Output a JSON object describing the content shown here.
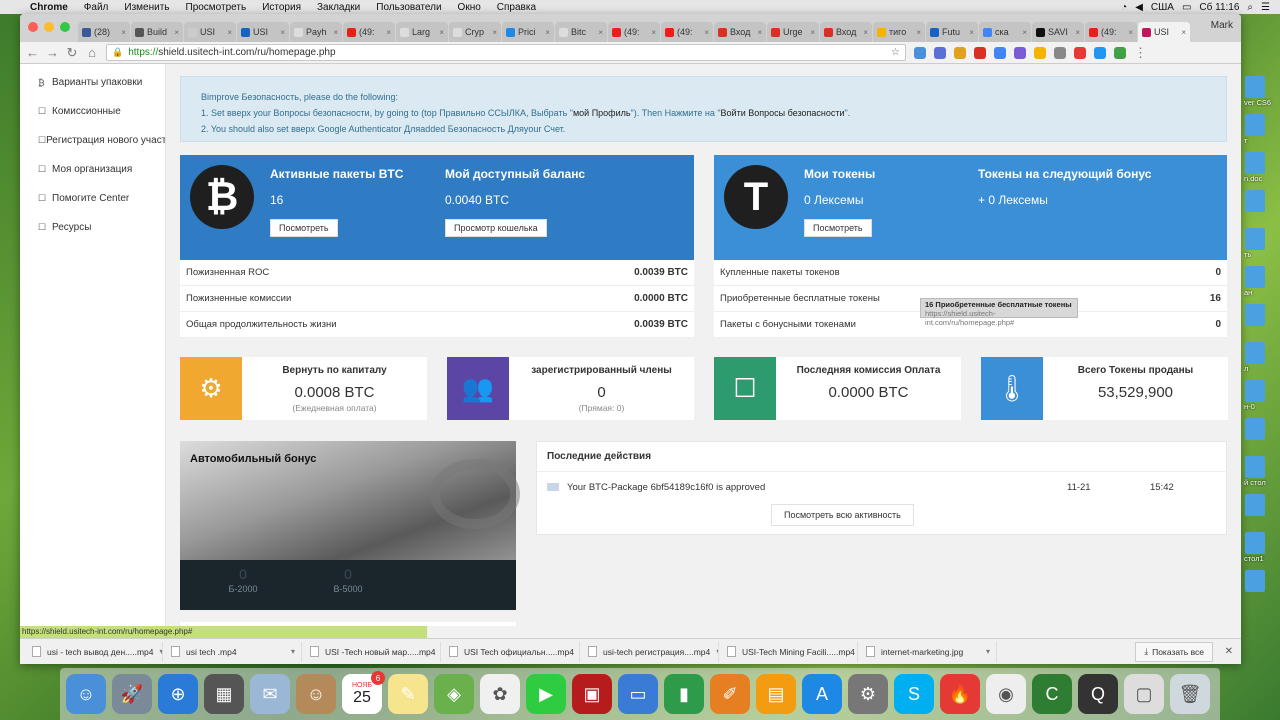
{
  "menubar": {
    "app": "Chrome",
    "items": [
      "Файл",
      "Изменить",
      "Просмотреть",
      "История",
      "Закладки",
      "Пользователи",
      "Окно",
      "Справка"
    ],
    "input_source": "США",
    "clock": "Сб 11:16"
  },
  "browser": {
    "tabs": [
      {
        "label": "(28)",
        "color": "#3b5998"
      },
      {
        "label": "Build",
        "color": "#555555"
      },
      {
        "label": "USI",
        "color": "#cccccc"
      },
      {
        "label": "USI",
        "color": "#1565c0"
      },
      {
        "label": "Payh",
        "color": "#dddddd"
      },
      {
        "label": "(49:",
        "color": "#e62117"
      },
      {
        "label": "Larg",
        "color": "#dddddd"
      },
      {
        "label": "Cryp",
        "color": "#dddddd"
      },
      {
        "label": "Prici",
        "color": "#1e88e5"
      },
      {
        "label": "Bitc",
        "color": "#dddddd"
      },
      {
        "label": "(49:",
        "color": "#e62117"
      },
      {
        "label": "(49:",
        "color": "#e62117"
      },
      {
        "label": "Вход",
        "color": "#d93025"
      },
      {
        "label": "Urge",
        "color": "#d93025"
      },
      {
        "label": "Вход",
        "color": "#d93025"
      },
      {
        "label": "тиго",
        "color": "#f4b400"
      },
      {
        "label": "Futu",
        "color": "#1565c0"
      },
      {
        "label": "ска",
        "color": "#4285f4"
      },
      {
        "label": "SAVI",
        "color": "#111111"
      },
      {
        "label": "(49:",
        "color": "#e62117"
      },
      {
        "label": "USI",
        "color": "#c2185b"
      }
    ],
    "profile": "Mark",
    "url_protocol": "https://",
    "url_rest": "shield.usitech-int.com/ru/homepage.php"
  },
  "sidebar": {
    "items": [
      {
        "icon": "₿",
        "label": "Варианты упаковки"
      },
      {
        "icon": "☐",
        "label": "Комиссионные"
      },
      {
        "icon": "☐",
        "label": "Регистрация нового участника"
      },
      {
        "icon": "☐",
        "label": "Моя организация"
      },
      {
        "icon": "☐",
        "label": "Помогите Center"
      },
      {
        "icon": "☐",
        "label": "Ресурсы"
      }
    ]
  },
  "alert": {
    "intro": "Bimprove Безопасность, please do the following:",
    "line1_prefix": "1. Set вверх your Вопросы безопасности, by going to (top Правильно ССЫЛКА, Выбрать \"",
    "line1_link1": "мой Профиль",
    "line1_mid": "\"). Then Нажмите на \"",
    "line1_link2": "Войти Вопросы безопасности",
    "line1_suffix": "\".",
    "line2": "2. You should also set вверх Google Authenticator Дляadded Безопасность Дляyour Счет."
  },
  "btc_panel": {
    "logo": "₿",
    "active_label": "Активные пакеты BTC",
    "active_value": "16",
    "active_btn": "Посмотреть",
    "balance_label": "Мой доступный баланс",
    "balance_value": "0.0040 BTC",
    "balance_btn": "Просмотр кошелька",
    "rows": [
      {
        "label": "Пожизненная ROC",
        "value": "0.0039 BTC"
      },
      {
        "label": "Пожизненные комиссии",
        "value": "0.0000 BTC"
      },
      {
        "label": "Общая продолжительность жизни",
        "value": "0.0039 BTC"
      }
    ]
  },
  "token_panel": {
    "logo": "T",
    "tokens_label": "Мои токены",
    "tokens_value": "0 Лексемы",
    "tokens_btn": "Посмотреть",
    "next_label": "Токены на следующий бонус",
    "next_value": "+ 0 Лексемы",
    "rows": [
      {
        "label": "Купленные пакеты токенов",
        "value": "0"
      },
      {
        "label": "Приобретенные бесплатные токены",
        "value": "16"
      },
      {
        "label": "Пакеты с бонусными токенами",
        "value": "0"
      }
    ]
  },
  "tooltip": {
    "title": "16 Приобретенные бесплатные токены",
    "url": "https://shield.usitech-int.com/ru/homepage.php#"
  },
  "tiles": [
    {
      "icon": "⚙",
      "color": "#f0a830",
      "title": "Вернуть по капиталу",
      "value": "0.0008 BTC",
      "sub": "(Ежедневная оплата)"
    },
    {
      "icon": "👥",
      "color": "#5b46a6",
      "title": "зарегистрированный члены",
      "value": "0",
      "sub": "(Прямая: 0)"
    },
    {
      "icon": "☐",
      "color": "#2e9b6e",
      "title": "Последняя комиссия Оплата",
      "value": "0.0000 BTC",
      "sub": ""
    },
    {
      "icon": "🌡",
      "color": "#3a8fd6",
      "title": "Всего Токены проданы",
      "value": "53,529,900",
      "sub": ""
    }
  ],
  "car_bonus": {
    "title": "Автомобильный бонус",
    "counters": [
      {
        "value": "0",
        "label": "Б-2000"
      },
      {
        "value": "0",
        "label": "В-5000"
      }
    ]
  },
  "activity": {
    "title": "Последние действия",
    "items": [
      {
        "text": "Your BTC-Package 6bf54189c16f0 is approved",
        "date": "11-21",
        "time": "15:42"
      }
    ],
    "button": "Посмотреть всю активность"
  },
  "status_url": "https://shield.usitech-int.com/ru/homepage.php#",
  "downloads": {
    "items": [
      "usi - tech  вывод ден.....mp4",
      "usi tech .mp4",
      "USI -Tech новый мар.....mp4",
      "USI Tech официальн.....mp4",
      "usi-tech регистрация....mp4",
      "USI-Tech Mining Facili.....mp4",
      "internet-marketing.jpg"
    ],
    "show_all": "Показать все"
  },
  "desktop": {
    "labels": [
      "ver CS6",
      "т",
      "n.doc",
      "",
      "ть",
      "ан",
      "",
      "л",
      "н-0",
      "",
      "й стол",
      "",
      "стол1",
      ""
    ]
  },
  "dock": {
    "calendar_day": "25",
    "calendar_month": "НОЯБ",
    "calendar_badge": "6",
    "apps": [
      {
        "name": "finder",
        "color": "#4a90d9",
        "glyph": "☺"
      },
      {
        "name": "launchpad",
        "color": "#7a8a99",
        "glyph": "🚀"
      },
      {
        "name": "safari",
        "color": "#2a7ad8",
        "glyph": "⊕"
      },
      {
        "name": "apps",
        "color": "#555555",
        "glyph": "▦"
      },
      {
        "name": "mail",
        "color": "#9ab7d6",
        "glyph": "✉"
      },
      {
        "name": "contacts",
        "color": "#b58a5a",
        "glyph": "☺"
      },
      {
        "name": "calendar",
        "color": "#ffffff",
        "glyph": ""
      },
      {
        "name": "notes",
        "color": "#f6e58d",
        "glyph": "✎"
      },
      {
        "name": "maps",
        "color": "#6ab04c",
        "glyph": "◈"
      },
      {
        "name": "photos",
        "color": "#f0f0f0",
        "glyph": "✿"
      },
      {
        "name": "facetime",
        "color": "#2ecc40",
        "glyph": "▶"
      },
      {
        "name": "photo-booth",
        "color": "#b71c1c",
        "glyph": "▣"
      },
      {
        "name": "keynote",
        "color": "#3a7bd5",
        "glyph": "▭"
      },
      {
        "name": "numbers",
        "color": "#2e9b4a",
        "glyph": "▮"
      },
      {
        "name": "pages",
        "color": "#e67e22",
        "glyph": "✐"
      },
      {
        "name": "ibooks",
        "color": "#f39c12",
        "glyph": "▤"
      },
      {
        "name": "app-store",
        "color": "#1e88e5",
        "glyph": "A"
      },
      {
        "name": "system-preferences",
        "color": "#777777",
        "glyph": "⚙"
      },
      {
        "name": "skype",
        "color": "#00aff0",
        "glyph": "S"
      },
      {
        "name": "hotspot-shield",
        "color": "#e53935",
        "glyph": "🔥"
      },
      {
        "name": "chrome",
        "color": "#eeeeee",
        "glyph": "◉"
      },
      {
        "name": "camtasia",
        "color": "#2e7d32",
        "glyph": "C"
      },
      {
        "name": "quicktime",
        "color": "#333333",
        "glyph": "Q"
      },
      {
        "name": "preview",
        "color": "#dddddd",
        "glyph": "▢"
      },
      {
        "name": "trash",
        "color": "#cfd8dc",
        "glyph": "🗑"
      }
    ]
  }
}
